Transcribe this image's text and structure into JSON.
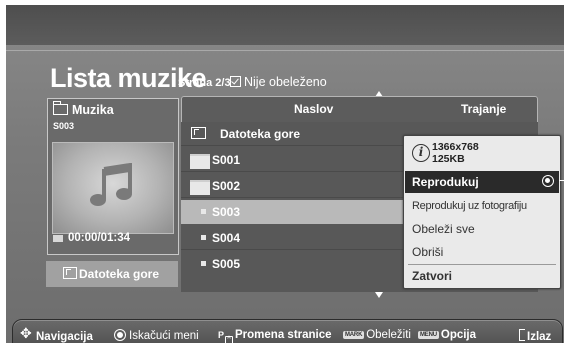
{
  "header": {
    "title": "Lista muzike",
    "page_label": "Strana 2/3",
    "marked_status": "Nije obeleženo"
  },
  "preview": {
    "folder": "Muzika",
    "file": "S003",
    "time": "00:00/01:34",
    "parent_button": "Datoteka gore"
  },
  "list": {
    "columns": [
      "Naslov",
      "Trajanje"
    ],
    "parent_row": "Datoteka gore",
    "items": [
      {
        "name": "S001",
        "type": "folder"
      },
      {
        "name": "S002",
        "type": "folder"
      },
      {
        "name": "S003",
        "type": "file",
        "selected": true
      },
      {
        "name": "S004",
        "type": "file"
      },
      {
        "name": "S005",
        "type": "file"
      }
    ]
  },
  "popup": {
    "resolution": "1366x768",
    "size": "125KB",
    "items": [
      "Reprodukuj",
      "Reprodukuj uz fotografiju",
      "Obeleži sve",
      "Obriši",
      "Zatvori"
    ],
    "active_item": "Reprodukuj"
  },
  "bottom_bar": {
    "navigation": "Navigacija",
    "popup_menu": "Iskačući meni",
    "page_key": "P",
    "page_change": "Promena stranice",
    "mark_key": "MARK",
    "mark": "Obeležiti",
    "menu_key": "MENU",
    "option": "Opcija",
    "exit": "Izlaz"
  },
  "colors": {
    "background": "#7b7b7b",
    "list_body": "#585858",
    "selected_row": "#b9b9b9",
    "popup": "#eaeaea",
    "popup_active": "#2a2a2a"
  }
}
